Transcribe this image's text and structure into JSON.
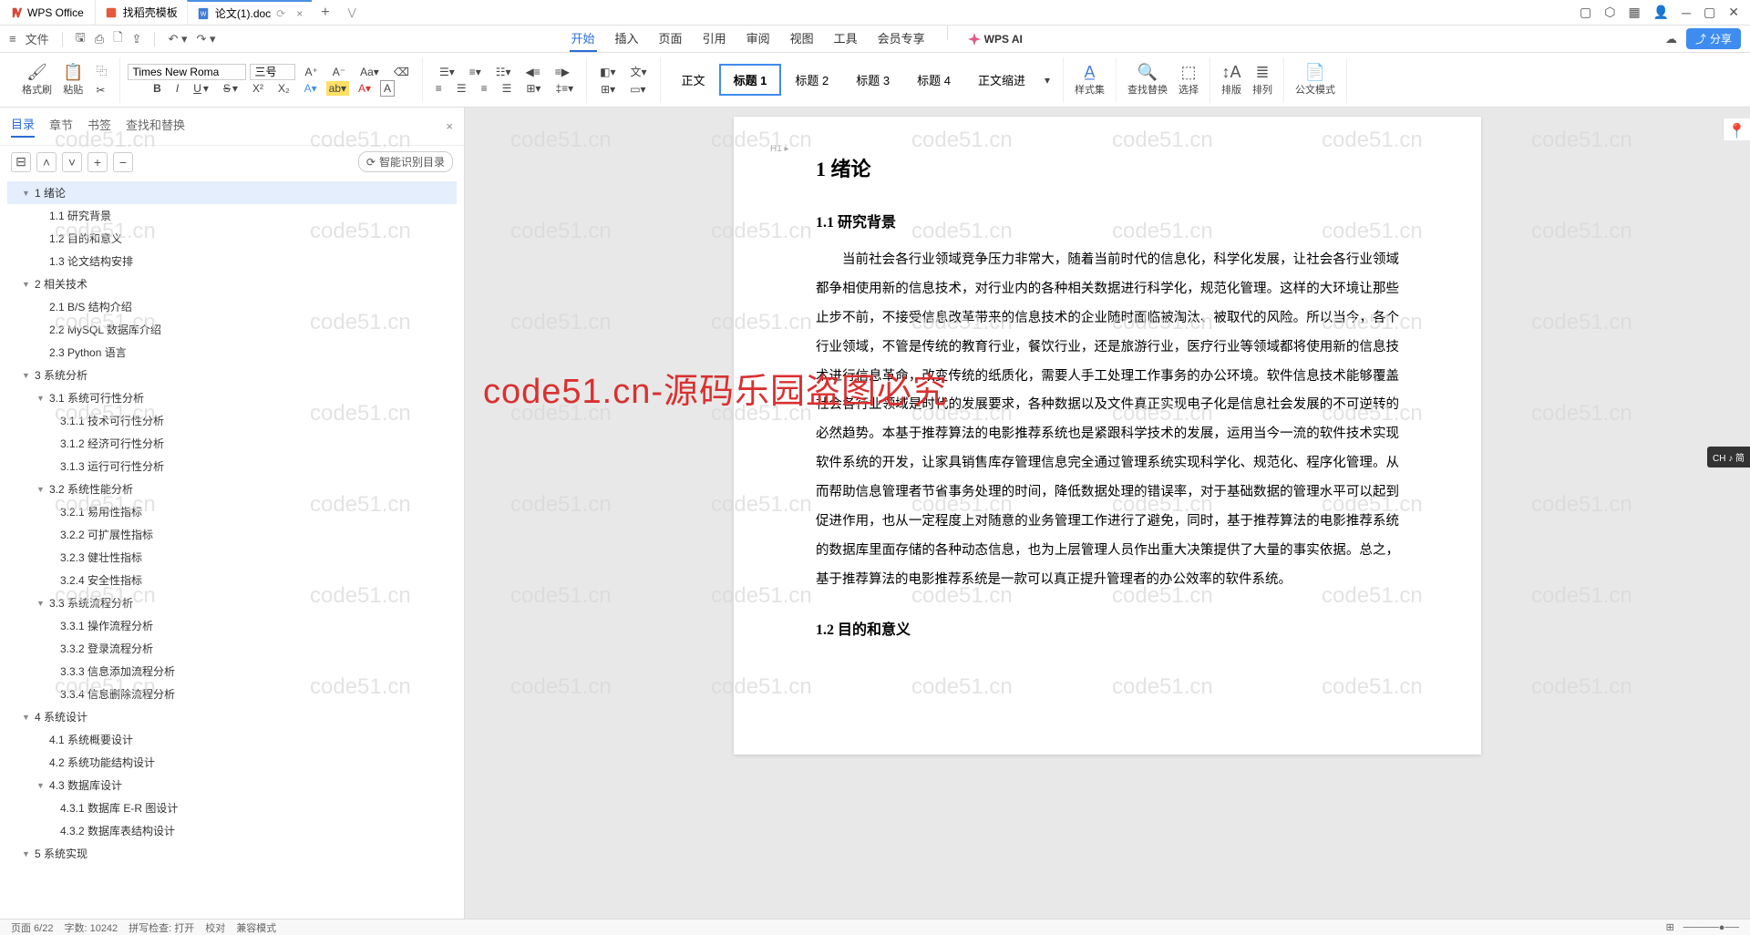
{
  "app": {
    "name": "WPS Office"
  },
  "tabs": [
    {
      "label": "找稻壳模板",
      "type": "template"
    },
    {
      "label": "论文(1).doc",
      "type": "doc",
      "active": true
    }
  ],
  "quickbar": {
    "file": "文件"
  },
  "menu": {
    "items": [
      "开始",
      "插入",
      "页面",
      "引用",
      "审阅",
      "视图",
      "工具",
      "会员专享"
    ],
    "active": "开始",
    "ai": "WPS AI"
  },
  "share": "分享",
  "ribbon": {
    "format_painter": "格式刷",
    "paste": "粘贴",
    "font": "Times New Roma",
    "size": "三号",
    "body": "正文",
    "headings": [
      "标题 1",
      "标题 2",
      "标题 3",
      "标题 4"
    ],
    "active_heading_idx": 0,
    "body_indent": "正文缩进",
    "style": "样式集",
    "find_replace": "查找替换",
    "select": "选择",
    "sort": "排版",
    "arrange": "排列",
    "official": "公文模式"
  },
  "nav": {
    "tabs": [
      "目录",
      "章节",
      "书签",
      "查找和替换"
    ],
    "active": "目录",
    "smart_toc": "智能识别目录"
  },
  "toc": [
    {
      "level": 0,
      "label": "1 绪论",
      "expand": true,
      "selected": true
    },
    {
      "level": 1,
      "label": "1.1 研究背景"
    },
    {
      "level": 1,
      "label": "1.2 目的和意义"
    },
    {
      "level": 1,
      "label": "1.3 论文结构安排"
    },
    {
      "level": 0,
      "label": "2 相关技术",
      "expand": true
    },
    {
      "level": 1,
      "label": "2.1 B/S 结构介绍"
    },
    {
      "level": 1,
      "label": "2.2 MySQL 数据库介绍"
    },
    {
      "level": 1,
      "label": "2.3 Python 语言"
    },
    {
      "level": 0,
      "label": "3 系统分析",
      "expand": true
    },
    {
      "level": 1,
      "label": "3.1 系统可行性分析",
      "expand": true
    },
    {
      "level": 2,
      "label": "3.1.1 技术可行性分析"
    },
    {
      "level": 2,
      "label": "3.1.2 经济可行性分析"
    },
    {
      "level": 2,
      "label": "3.1.3 运行可行性分析"
    },
    {
      "level": 1,
      "label": "3.2 系统性能分析",
      "expand": true
    },
    {
      "level": 2,
      "label": "3.2.1 易用性指标"
    },
    {
      "level": 2,
      "label": "3.2.2 可扩展性指标"
    },
    {
      "level": 2,
      "label": "3.2.3 健壮性指标"
    },
    {
      "level": 2,
      "label": "3.2.4 安全性指标"
    },
    {
      "level": 1,
      "label": "3.3 系统流程分析",
      "expand": true
    },
    {
      "level": 2,
      "label": "3.3.1 操作流程分析"
    },
    {
      "level": 2,
      "label": "3.3.2 登录流程分析"
    },
    {
      "level": 2,
      "label": "3.3.3 信息添加流程分析"
    },
    {
      "level": 2,
      "label": "3.3.4 信息删除流程分析"
    },
    {
      "level": 0,
      "label": "4 系统设计",
      "expand": true
    },
    {
      "level": 1,
      "label": "4.1 系统概要设计"
    },
    {
      "level": 1,
      "label": "4.2 系统功能结构设计"
    },
    {
      "level": 1,
      "label": "4.3 数据库设计",
      "expand": true
    },
    {
      "level": 2,
      "label": "4.3.1 数据库 E-R 图设计"
    },
    {
      "level": 2,
      "label": "4.3.2 数据库表结构设计"
    },
    {
      "level": 0,
      "label": "5 系统实现",
      "expand": true
    }
  ],
  "document": {
    "h1": "1 绪论",
    "h2_1": "1.1 研究背景",
    "paragraph": "当前社会各行业领域竞争压力非常大，随着当前时代的信息化，科学化发展，让社会各行业领域都争相使用新的信息技术，对行业内的各种相关数据进行科学化，规范化管理。这样的大环境让那些止步不前，不接受信息改革带来的信息技术的企业随时面临被淘汰、被取代的风险。所以当今，各个行业领域，不管是传统的教育行业，餐饮行业，还是旅游行业，医疗行业等领域都将使用新的信息技术进行信息革命，改变传统的纸质化，需要人手工处理工作事务的办公环境。软件信息技术能够覆盖社会各行业领域是时代的发展要求，各种数据以及文件真正实现电子化是信息社会发展的不可逆转的必然趋势。本基于推荐算法的电影推荐系统也是紧跟科学技术的发展，运用当今一流的软件技术实现软件系统的开发，让家具销售库存管理信息完全通过管理系统实现科学化、规范化、程序化管理。从而帮助信息管理者节省事务处理的时间，降低数据处理的错误率，对于基础数据的管理水平可以起到促进作用，也从一定程度上对随意的业务管理工作进行了避免，同时，基于推荐算法的电影推荐系统的数据库里面存储的各种动态信息，也为上层管理人员作出重大决策提供了大量的事实依据。总之，基于推荐算法的电影推荐系统是一款可以真正提升管理者的办公效率的软件系统。",
    "h2_2": "1.2 目的和意义"
  },
  "status": {
    "page": "页面 6/22",
    "words": "字数: 10242",
    "spellcheck": "拼写检查: 打开",
    "proof": "校对",
    "mode": "兼容模式"
  },
  "watermark_text": "code51.cn",
  "big_watermark": "code51.cn-源码乐园盗图必究",
  "ime": "CH ♪ 简"
}
